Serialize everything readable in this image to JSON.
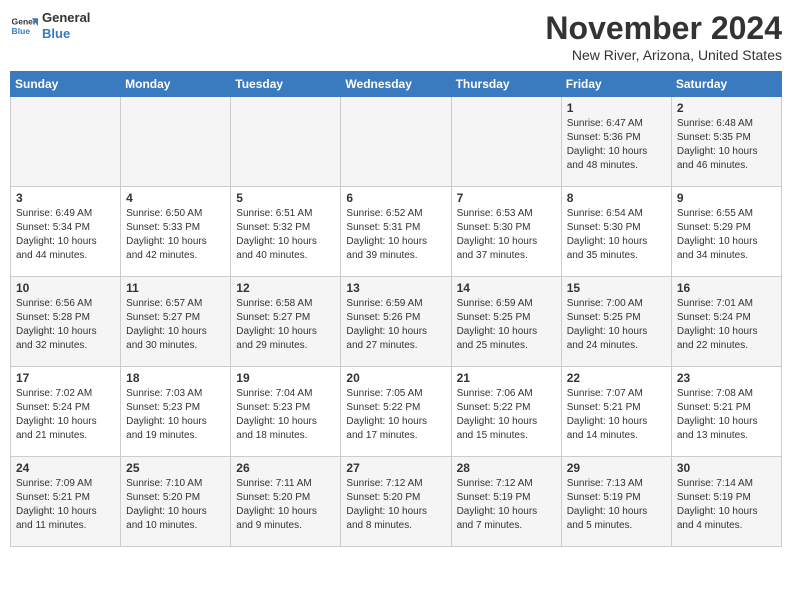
{
  "header": {
    "logo_line1": "General",
    "logo_line2": "Blue",
    "month_title": "November 2024",
    "location": "New River, Arizona, United States"
  },
  "days_of_week": [
    "Sunday",
    "Monday",
    "Tuesday",
    "Wednesday",
    "Thursday",
    "Friday",
    "Saturday"
  ],
  "weeks": [
    [
      {
        "day": "",
        "info": ""
      },
      {
        "day": "",
        "info": ""
      },
      {
        "day": "",
        "info": ""
      },
      {
        "day": "",
        "info": ""
      },
      {
        "day": "",
        "info": ""
      },
      {
        "day": "1",
        "info": "Sunrise: 6:47 AM\nSunset: 5:36 PM\nDaylight: 10 hours and 48 minutes."
      },
      {
        "day": "2",
        "info": "Sunrise: 6:48 AM\nSunset: 5:35 PM\nDaylight: 10 hours and 46 minutes."
      }
    ],
    [
      {
        "day": "3",
        "info": "Sunrise: 6:49 AM\nSunset: 5:34 PM\nDaylight: 10 hours and 44 minutes."
      },
      {
        "day": "4",
        "info": "Sunrise: 6:50 AM\nSunset: 5:33 PM\nDaylight: 10 hours and 42 minutes."
      },
      {
        "day": "5",
        "info": "Sunrise: 6:51 AM\nSunset: 5:32 PM\nDaylight: 10 hours and 40 minutes."
      },
      {
        "day": "6",
        "info": "Sunrise: 6:52 AM\nSunset: 5:31 PM\nDaylight: 10 hours and 39 minutes."
      },
      {
        "day": "7",
        "info": "Sunrise: 6:53 AM\nSunset: 5:30 PM\nDaylight: 10 hours and 37 minutes."
      },
      {
        "day": "8",
        "info": "Sunrise: 6:54 AM\nSunset: 5:30 PM\nDaylight: 10 hours and 35 minutes."
      },
      {
        "day": "9",
        "info": "Sunrise: 6:55 AM\nSunset: 5:29 PM\nDaylight: 10 hours and 34 minutes."
      }
    ],
    [
      {
        "day": "10",
        "info": "Sunrise: 6:56 AM\nSunset: 5:28 PM\nDaylight: 10 hours and 32 minutes."
      },
      {
        "day": "11",
        "info": "Sunrise: 6:57 AM\nSunset: 5:27 PM\nDaylight: 10 hours and 30 minutes."
      },
      {
        "day": "12",
        "info": "Sunrise: 6:58 AM\nSunset: 5:27 PM\nDaylight: 10 hours and 29 minutes."
      },
      {
        "day": "13",
        "info": "Sunrise: 6:59 AM\nSunset: 5:26 PM\nDaylight: 10 hours and 27 minutes."
      },
      {
        "day": "14",
        "info": "Sunrise: 6:59 AM\nSunset: 5:25 PM\nDaylight: 10 hours and 25 minutes."
      },
      {
        "day": "15",
        "info": "Sunrise: 7:00 AM\nSunset: 5:25 PM\nDaylight: 10 hours and 24 minutes."
      },
      {
        "day": "16",
        "info": "Sunrise: 7:01 AM\nSunset: 5:24 PM\nDaylight: 10 hours and 22 minutes."
      }
    ],
    [
      {
        "day": "17",
        "info": "Sunrise: 7:02 AM\nSunset: 5:24 PM\nDaylight: 10 hours and 21 minutes."
      },
      {
        "day": "18",
        "info": "Sunrise: 7:03 AM\nSunset: 5:23 PM\nDaylight: 10 hours and 19 minutes."
      },
      {
        "day": "19",
        "info": "Sunrise: 7:04 AM\nSunset: 5:23 PM\nDaylight: 10 hours and 18 minutes."
      },
      {
        "day": "20",
        "info": "Sunrise: 7:05 AM\nSunset: 5:22 PM\nDaylight: 10 hours and 17 minutes."
      },
      {
        "day": "21",
        "info": "Sunrise: 7:06 AM\nSunset: 5:22 PM\nDaylight: 10 hours and 15 minutes."
      },
      {
        "day": "22",
        "info": "Sunrise: 7:07 AM\nSunset: 5:21 PM\nDaylight: 10 hours and 14 minutes."
      },
      {
        "day": "23",
        "info": "Sunrise: 7:08 AM\nSunset: 5:21 PM\nDaylight: 10 hours and 13 minutes."
      }
    ],
    [
      {
        "day": "24",
        "info": "Sunrise: 7:09 AM\nSunset: 5:21 PM\nDaylight: 10 hours and 11 minutes."
      },
      {
        "day": "25",
        "info": "Sunrise: 7:10 AM\nSunset: 5:20 PM\nDaylight: 10 hours and 10 minutes."
      },
      {
        "day": "26",
        "info": "Sunrise: 7:11 AM\nSunset: 5:20 PM\nDaylight: 10 hours and 9 minutes."
      },
      {
        "day": "27",
        "info": "Sunrise: 7:12 AM\nSunset: 5:20 PM\nDaylight: 10 hours and 8 minutes."
      },
      {
        "day": "28",
        "info": "Sunrise: 7:12 AM\nSunset: 5:19 PM\nDaylight: 10 hours and 7 minutes."
      },
      {
        "day": "29",
        "info": "Sunrise: 7:13 AM\nSunset: 5:19 PM\nDaylight: 10 hours and 5 minutes."
      },
      {
        "day": "30",
        "info": "Sunrise: 7:14 AM\nSunset: 5:19 PM\nDaylight: 10 hours and 4 minutes."
      }
    ]
  ]
}
